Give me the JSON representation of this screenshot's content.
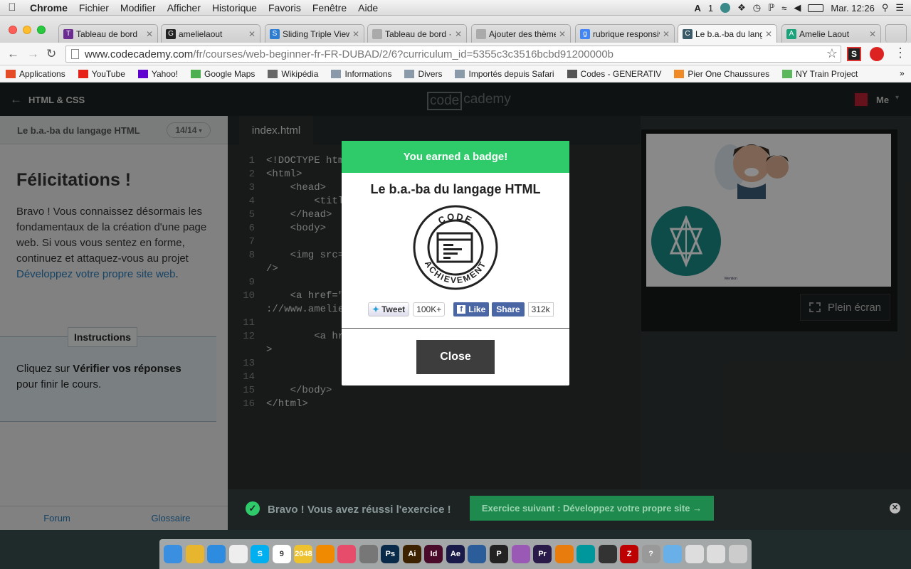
{
  "menubar": {
    "app": "Chrome",
    "items": [
      "Fichier",
      "Modifier",
      "Afficher",
      "Historique",
      "Favoris",
      "Fenêtre",
      "Aide"
    ],
    "status_num": "1",
    "clock": "Mar. 12:26"
  },
  "tabs": [
    {
      "title": "Tableau de bord",
      "color": "#6a2c91",
      "icon": "T"
    },
    {
      "title": "amelielaout",
      "color": "#222222",
      "icon": "G"
    },
    {
      "title": "Sliding Triple View",
      "color": "#2d7dd2",
      "icon": "S"
    },
    {
      "title": "Tableau de bord ·",
      "color": "#aaaaaa",
      "icon": ""
    },
    {
      "title": "Ajouter des thèmes",
      "color": "#aaaaaa",
      "icon": ""
    },
    {
      "title": "rubrique responsive",
      "color": "#4285f4",
      "icon": "g"
    },
    {
      "title": "Le b.a.-ba du langage",
      "color": "#3a5a6a",
      "icon": "C"
    },
    {
      "title": "Amelie Laout",
      "color": "#1aa37a",
      "icon": "A"
    }
  ],
  "url": {
    "host": "www.codecademy.com",
    "path": "/fr/courses/web-beginner-fr-FR-DUBAD/2/6?curriculum_id=5355c3c3516bcbd91200000b"
  },
  "bookmarks": [
    {
      "label": "Applications",
      "color": "#e34c26"
    },
    {
      "label": "YouTube",
      "color": "#e62117"
    },
    {
      "label": "Yahoo!",
      "color": "#5f01d1"
    },
    {
      "label": "Google Maps",
      "color": "#4caf50"
    },
    {
      "label": "Wikipédia",
      "color": "#666666"
    },
    {
      "label": "Informations",
      "color": "#8a9aa8"
    },
    {
      "label": "Divers",
      "color": "#8a9aa8"
    },
    {
      "label": "Importés depuis Safari",
      "color": "#8a9aa8"
    },
    {
      "label": "Codes - GENERATIV",
      "color": "#555555"
    },
    {
      "label": "Pier One Chaussures",
      "color": "#f08a24"
    },
    {
      "label": "NY Train Project",
      "color": "#5cb85c"
    }
  ],
  "cc": {
    "back_label": "HTML & CSS",
    "logo_left": "code",
    "logo_right": "cademy",
    "user": "Me",
    "lesson_title": "Le b.a.-ba du langage HTML",
    "progress": "14/14",
    "heading": "Félicitations !",
    "body_1": "Bravo ! Vous connaissez désormais les fondamentaux de la création d'une page web. Si vous vous sentez en forme, continuez et attaquez-vous au projet ",
    "body_link": "Développez votre propre site web",
    "body_2": ".",
    "instructions_tab": "Instructions",
    "instr_1": "Cliquez sur ",
    "instr_bold": "Vérifier vos réponses",
    "instr_2": " pour finir le cours.",
    "forum": "Forum",
    "glossary": "Glossaire",
    "file_tab": "index.html",
    "fullscreen": "Plein écran",
    "preview_caption": "Mention",
    "success_msg": "Bravo ! Vous avez réussi l'exercice !",
    "next_btn": "Exercice suivant : Développez votre propre site →"
  },
  "code_lines": [
    {
      "n": "1",
      "text": "<!DOCTYPE htm"
    },
    {
      "n": "2",
      "text": "<html>"
    },
    {
      "n": "3",
      "text": "    <head>"
    },
    {
      "n": "4",
      "text": "        <titl"
    },
    {
      "n": "5",
      "text": "    </head>"
    },
    {
      "n": "6",
      "text": "    <body>"
    },
    {
      "n": "7",
      "text": ""
    },
    {
      "n": "8",
      "text": "    <img src=                          ie.png\""
    },
    {
      "n": "",
      "text": "/>"
    },
    {
      "n": "9",
      "text": ""
    },
    {
      "n": "10",
      "text": "    <a href=\"                         \"http"
    },
    {
      "n": "",
      "text": "://www.amelie"
    },
    {
      "n": "11",
      "text": ""
    },
    {
      "n": "12",
      "text": "        <a hr                          ite !</a"
    },
    {
      "n": "",
      "text": ">"
    },
    {
      "n": "13",
      "text": ""
    },
    {
      "n": "14",
      "text": ""
    },
    {
      "n": "15",
      "text": "    </body>"
    },
    {
      "n": "16",
      "text": "</html>"
    }
  ],
  "modal": {
    "header": "You earned a badge!",
    "title": "Le b.a.-ba du langage HTML",
    "badge_top": "CODE",
    "badge_bottom": "ACHIEVEMENT",
    "tweet": "Tweet",
    "tweet_count": "100K+",
    "like": "Like",
    "share": "Share",
    "share_count": "312k",
    "close": "Close"
  },
  "dock": [
    {
      "name": "finder",
      "color": "#3b8fe0"
    },
    {
      "name": "chrome",
      "color": "#e8b52e"
    },
    {
      "name": "safari",
      "color": "#2d8be0"
    },
    {
      "name": "textedit",
      "color": "#eeeeee"
    },
    {
      "name": "skype",
      "color": "#00aff0",
      "label": "S"
    },
    {
      "name": "calendar",
      "color": "#ffffff",
      "label": "9"
    },
    {
      "name": "2048",
      "color": "#edc22e",
      "label": "2048"
    },
    {
      "name": "vlc",
      "color": "#f08a00"
    },
    {
      "name": "itunes",
      "color": "#e74c6a"
    },
    {
      "name": "font-book",
      "color": "#777777"
    },
    {
      "name": "photoshop",
      "color": "#0a2a4a",
      "label": "Ps"
    },
    {
      "name": "illustrator",
      "color": "#3d2200",
      "label": "Ai"
    },
    {
      "name": "indesign",
      "color": "#4a0a2a",
      "label": "Id"
    },
    {
      "name": "after-effects",
      "color": "#1a1a4a",
      "label": "Ae"
    },
    {
      "name": "window-tool",
      "color": "#2a5d9a"
    },
    {
      "name": "pixate",
      "color": "#222222",
      "label": "P"
    },
    {
      "name": "podcast",
      "color": "#9b59b6"
    },
    {
      "name": "premiere",
      "color": "#2a1a4a",
      "label": "Pr"
    },
    {
      "name": "blender",
      "color": "#e87d0d"
    },
    {
      "name": "arduino",
      "color": "#00979c"
    },
    {
      "name": "github",
      "color": "#333333"
    },
    {
      "name": "filezilla",
      "color": "#bf0000",
      "label": "Z"
    },
    {
      "name": "help",
      "color": "#999999",
      "label": "?"
    },
    {
      "name": "folder",
      "color": "#6ab0e8"
    },
    {
      "name": "documents",
      "color": "#dddddd"
    },
    {
      "name": "downloads",
      "color": "#dddddd"
    },
    {
      "name": "trash",
      "color": "#cccccc"
    }
  ]
}
